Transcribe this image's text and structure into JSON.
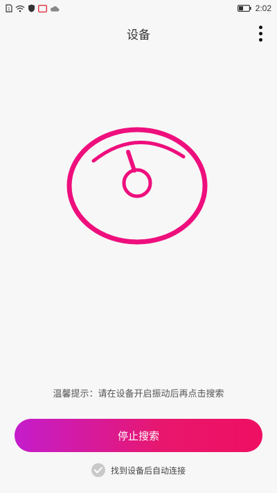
{
  "status_bar": {
    "time": "2:02",
    "icons": [
      "sim-icon",
      "wifi-icon",
      "shield-icon",
      "screen-icon",
      "cloud-icon",
      "battery-icon"
    ]
  },
  "header": {
    "title": "设备",
    "menu_icon": "more-vertical-icon"
  },
  "scale": {
    "icon": "scale-icon",
    "color": "#ee0f7d"
  },
  "hint": "温馨提示：请在设备开启振动后再点击搜索",
  "action": {
    "stop_label": "停止搜索",
    "gradient": [
      "#c41dcc",
      "#ef0f62"
    ]
  },
  "auto_connect": {
    "label": "找到设备后自动连接",
    "checked": true
  }
}
